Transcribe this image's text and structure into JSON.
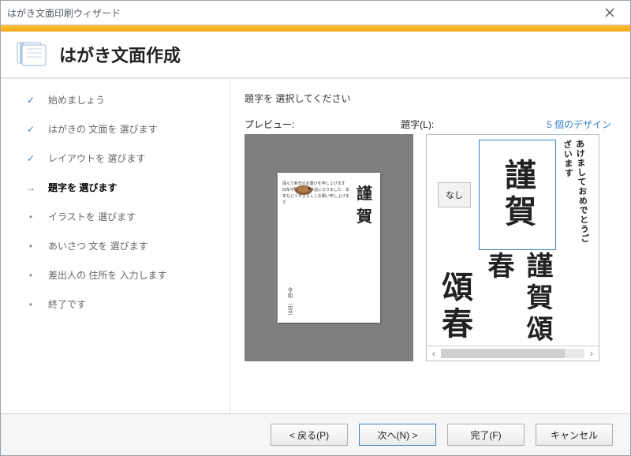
{
  "window": {
    "title": "はがき文面印刷ウィザード"
  },
  "header": {
    "title": "はがき文面作成"
  },
  "steps": [
    {
      "label": "始めましょう",
      "state": "done"
    },
    {
      "label": "はがきの 文面を 選びます",
      "state": "done"
    },
    {
      "label": "レイアウトを 選びます",
      "state": "done"
    },
    {
      "label": "題字を 選びます",
      "state": "current"
    },
    {
      "label": "イラストを 選びます",
      "state": "pending"
    },
    {
      "label": "あいさつ 文を 選びます",
      "state": "pending"
    },
    {
      "label": "差出人の 住所を 入力します",
      "state": "pending"
    },
    {
      "label": "終了です",
      "state": "pending"
    }
  ],
  "content": {
    "instruction": "題字を 選択してください",
    "preview_label": "プレビュー:",
    "picker_label": "題字(L):",
    "design_count": "5 個のデザイン",
    "none_label": "なし",
    "options": [
      "謹賀",
      "謹賀頌春",
      "頌春",
      "あけましておめでとうございます"
    ],
    "selected_index": 1,
    "preview_title": "謹賀"
  },
  "footer": {
    "back": "< 戻る(P)",
    "next": "次へ(N) >",
    "finish": "完了(F)",
    "cancel": "キャンセル"
  }
}
